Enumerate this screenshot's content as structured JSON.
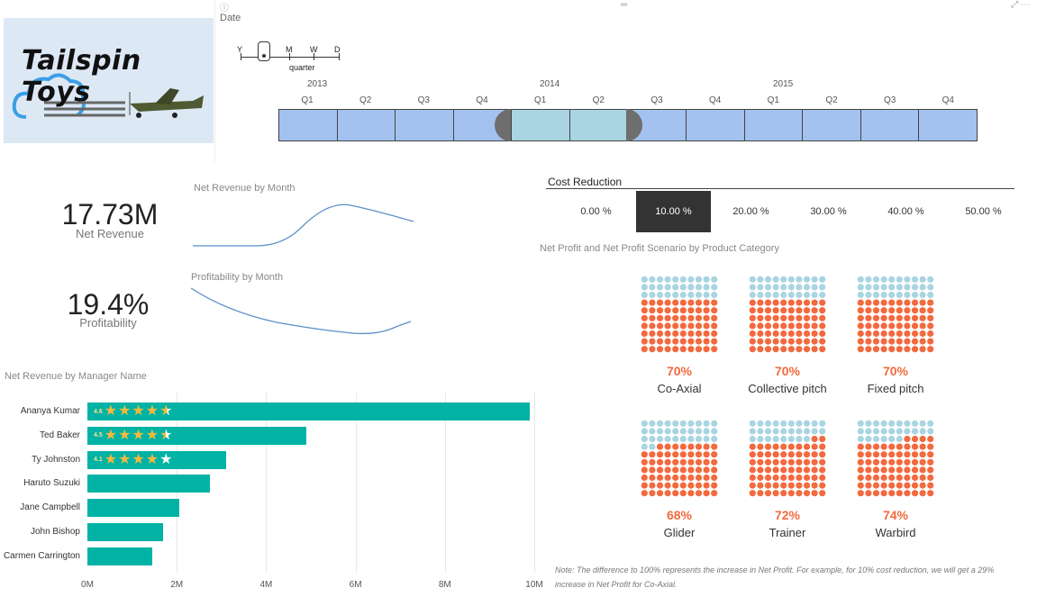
{
  "logo": {
    "text": "Tailspin Toys"
  },
  "date_slicer": {
    "title": "Date",
    "info_glyph": "ⓘ",
    "grip_glyph": "═",
    "header_controls": "⤢ ⋯",
    "granularity_levels": [
      "Y",
      "Q",
      "M",
      "W",
      "D"
    ],
    "selected_granularity": "quarter",
    "years": [
      "2013",
      "2014",
      "2015"
    ],
    "quarters": [
      "Q1",
      "Q2",
      "Q3",
      "Q4",
      "Q1",
      "Q2",
      "Q3",
      "Q4",
      "Q1",
      "Q2",
      "Q3",
      "Q4"
    ],
    "selected_quarters": [
      4,
      5
    ]
  },
  "kpis": {
    "revenue": {
      "value": "17.73M",
      "label": "Net Revenue"
    },
    "profitability": {
      "value": "19.4%",
      "label": "Profitability"
    }
  },
  "sparklines": {
    "revenue_title": "Net Revenue by Month",
    "profit_title": "Profitability by Month",
    "color": "#5b8fc9"
  },
  "manager_chart": {
    "title": "Net Revenue by Manager Name",
    "color": "#00b3a5"
  },
  "chart_data": {
    "type": "bar",
    "orientation": "horizontal",
    "title": "Net Revenue by Manager Name",
    "categories": [
      "Ananya Kumar",
      "Ted Baker",
      "Ty Johnston",
      "Haruto Suzuki",
      "Jane Campbell",
      "John Bishop",
      "Carmen Carrington"
    ],
    "values": [
      9.9,
      4.9,
      3.1,
      2.75,
      2.05,
      1.7,
      1.45
    ],
    "units": "M",
    "xlim": [
      0,
      10
    ],
    "xticks": [
      "0M",
      "2M",
      "4M",
      "6M",
      "8M",
      "10M"
    ],
    "grid": true,
    "ratings": [
      {
        "manager": "Ananya Kumar",
        "value": "4.6",
        "stars": 4.6
      },
      {
        "manager": "Ted Baker",
        "value": "4.5",
        "stars": 4.5
      },
      {
        "manager": "Ty Johnston",
        "value": "4.1",
        "stars": 4.1
      }
    ]
  },
  "cost_reduction": {
    "title": "Cost Reduction",
    "options": [
      "0.00 %",
      "10.00 %",
      "20.00 %",
      "30.00 %",
      "40.00 %",
      "50.00 %"
    ],
    "selected_index": 1
  },
  "net_profit": {
    "title": "Net Profit and Net Profit Scenario by Product Category",
    "categories": [
      {
        "name": "Co-Axial",
        "pct_label": "70%",
        "fill": 0.7
      },
      {
        "name": "Collective pitch",
        "pct_label": "70%",
        "fill": 0.7
      },
      {
        "name": "Fixed pitch",
        "pct_label": "70%",
        "fill": 0.7
      },
      {
        "name": "Glider",
        "pct_label": "68%",
        "fill": 0.68
      },
      {
        "name": "Trainer",
        "pct_label": "72%",
        "fill": 0.72
      },
      {
        "name": "Warbird",
        "pct_label": "74%",
        "fill": 0.74
      }
    ],
    "fill_color": "#f26a3f",
    "empty_color": "#a9d5e2",
    "note": "Note: The difference to 100% represents the increase in Net Profit. For example, for 10% cost reduction, we will get a 29% increase in Net Profit for Co-Axial."
  }
}
